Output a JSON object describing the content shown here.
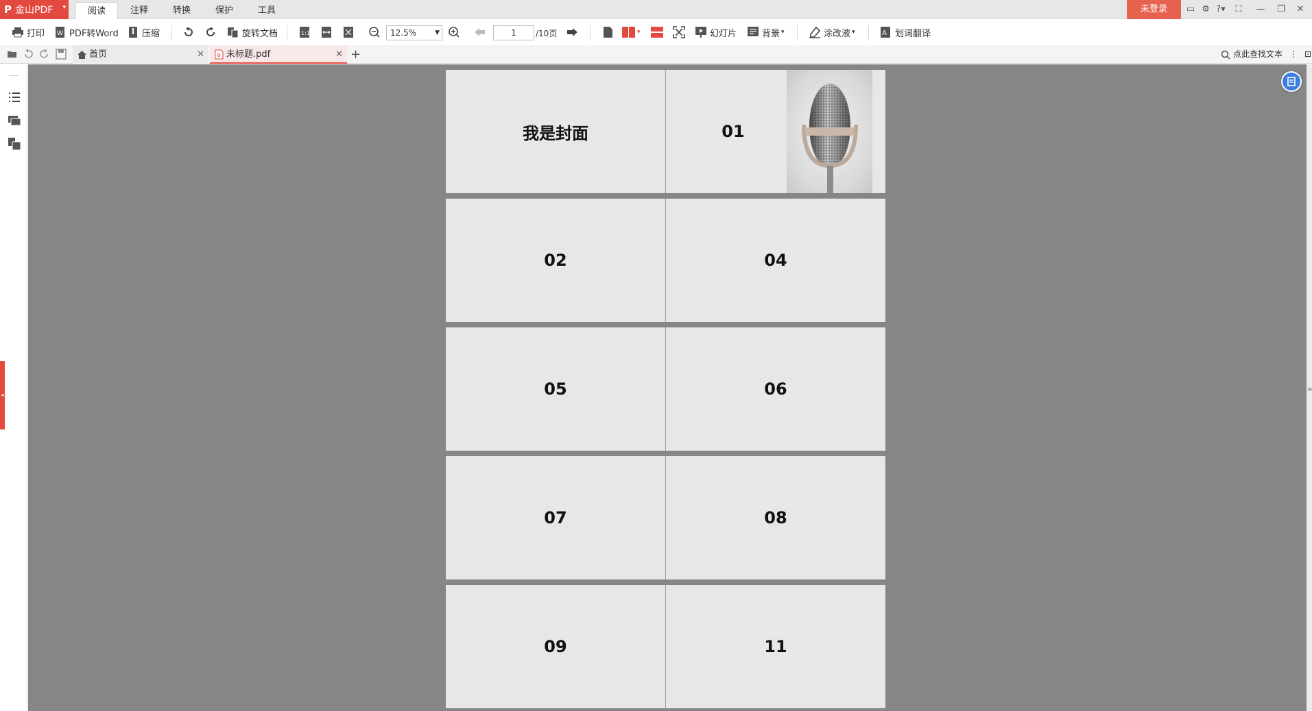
{
  "app": {
    "logo_text": "金山PDF",
    "login_label": "未登录"
  },
  "menu": {
    "tabs": [
      "阅读",
      "注释",
      "转换",
      "保护",
      "工具"
    ]
  },
  "toolbar": {
    "print": "打印",
    "pdf_to_word": "PDF转Word",
    "compress": "压缩",
    "rotate_doc": "旋转文档",
    "zoom": "12.5%",
    "page_current": "1",
    "page_total": "/10页",
    "slideshow": "幻灯片",
    "background": "背景",
    "correction": "涂改液",
    "translate": "划词翻译"
  },
  "tabs": {
    "home": "首页",
    "file": "未标题.pdf",
    "find_text": "点此查找文本"
  },
  "pages": {
    "rows": [
      [
        "我是封面",
        "01"
      ],
      [
        "02",
        "04"
      ],
      [
        "05",
        "06"
      ],
      [
        "07",
        "08"
      ],
      [
        "09",
        "11"
      ]
    ]
  },
  "icons": [
    "print-icon",
    "word-icon",
    "compress-icon",
    "rotate-left-icon",
    "rotate-right-icon",
    "zoom-out-icon",
    "zoom-in-icon",
    "prev-page-icon",
    "next-page-icon",
    "single-page-icon",
    "double-page-icon",
    "continuous-icon",
    "fullscreen-icon",
    "slideshow-icon",
    "background-icon",
    "eraser-icon",
    "translate-icon",
    "home-icon",
    "pdf-icon",
    "search-icon",
    "outline-icon",
    "comment-icon",
    "thumbnail-icon"
  ],
  "colors": {
    "brand": "#e34a3f",
    "viewport_bg": "#868686",
    "page_bg": "#e7e7e7",
    "accent_blue": "#3d7de0"
  }
}
